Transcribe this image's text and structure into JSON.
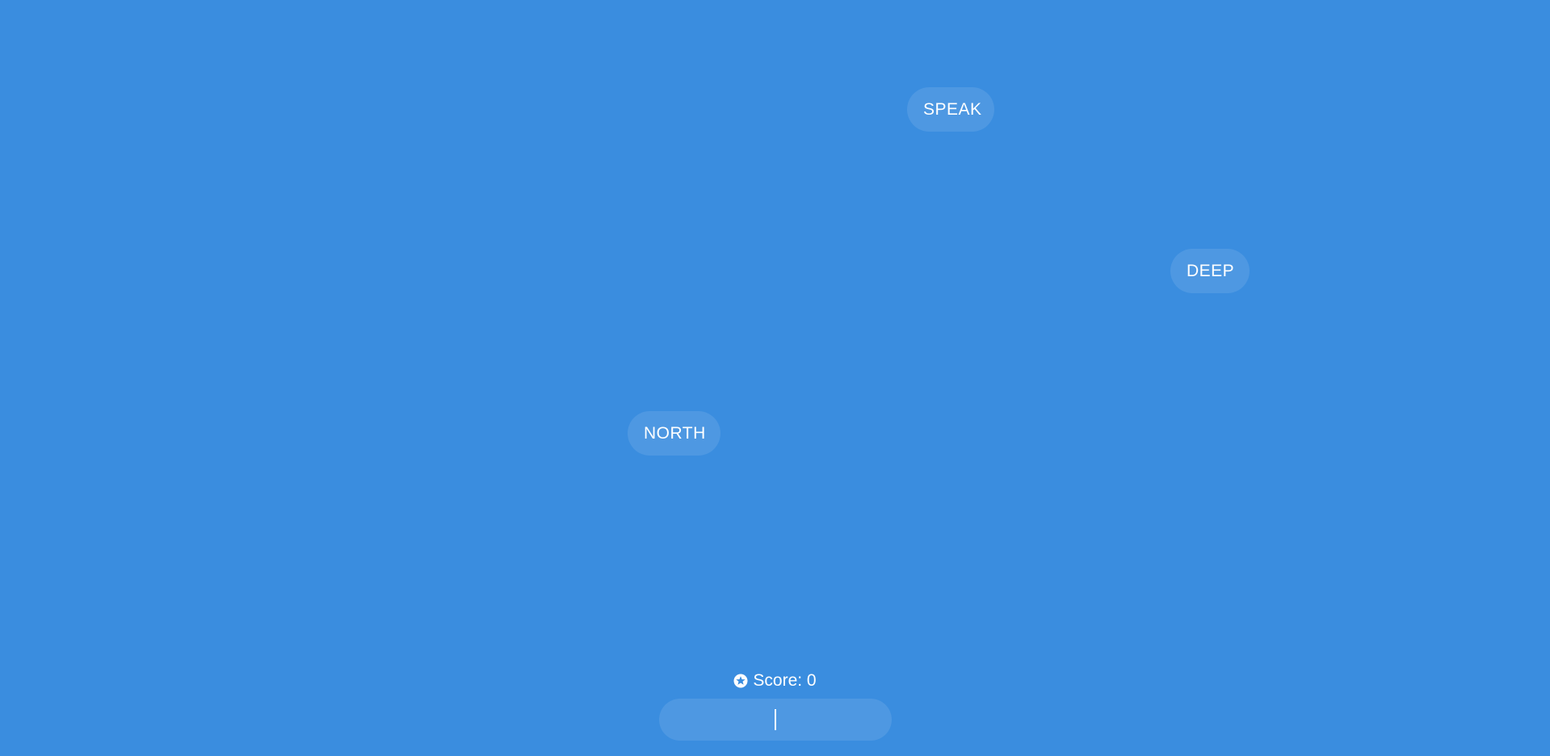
{
  "words": [
    {
      "text": "SPEAK"
    },
    {
      "text": "DEEP"
    },
    {
      "text": "NORTH"
    }
  ],
  "score": {
    "label": "Score: 0",
    "icon": "star-icon"
  },
  "input": {
    "value": "",
    "placeholder": ""
  },
  "colors": {
    "background": "#3a8ddf",
    "text": "#ffffff"
  }
}
